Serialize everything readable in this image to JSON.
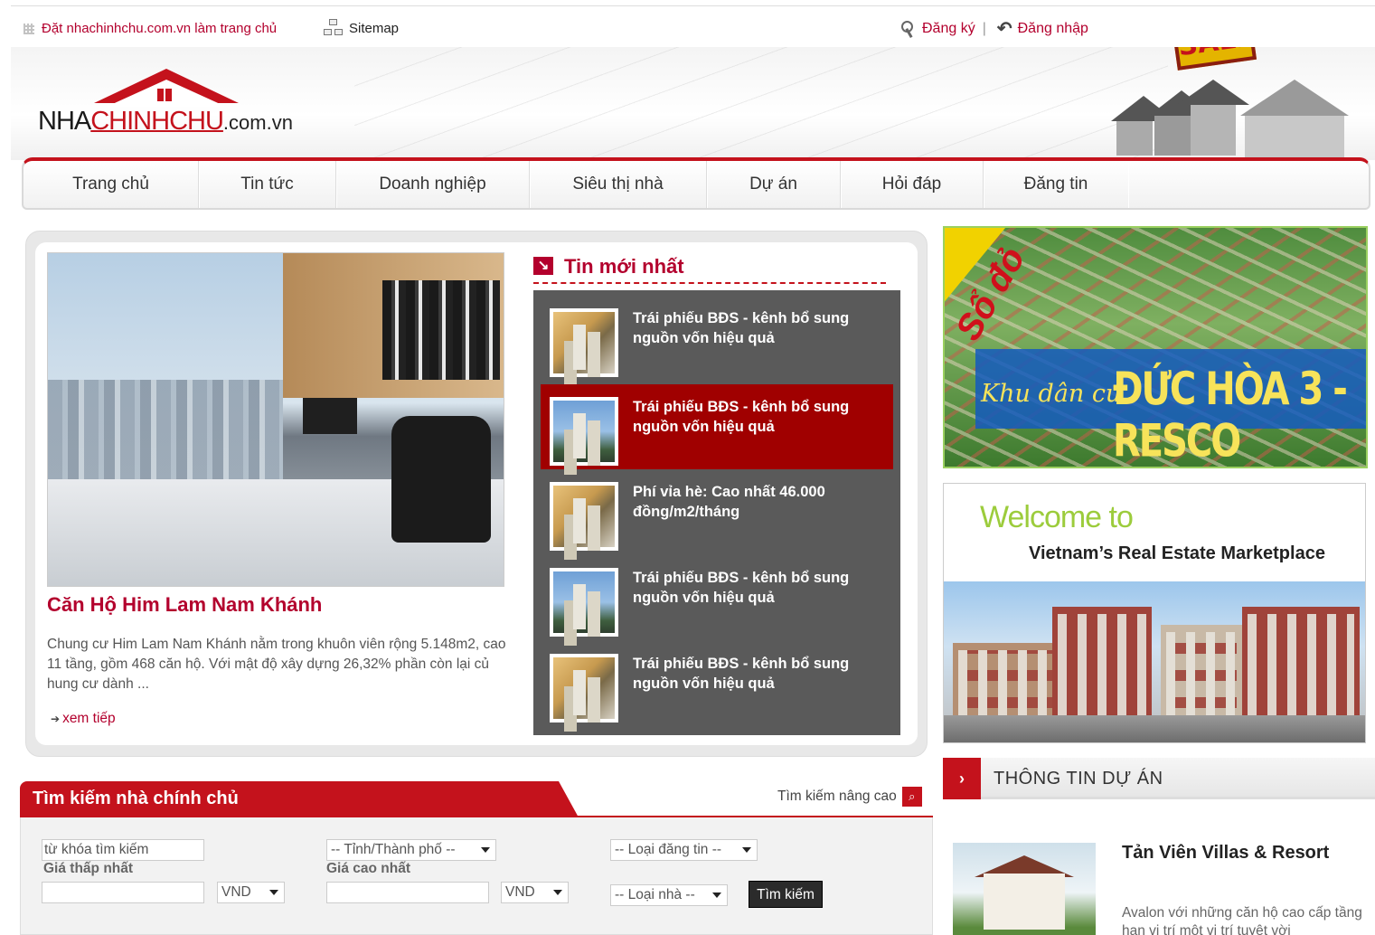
{
  "topbar": {
    "homepage_link": "Đặt nhachinhchu.com.vn làm trang chủ",
    "sitemap": "Sitemap",
    "register": "Đăng ký",
    "separator": "|",
    "login": "Đăng nhập"
  },
  "logo": {
    "part1": "NHA",
    "part2": "CHINHCHU",
    "domain": ".com.vn"
  },
  "sale_sign": "SALE",
  "nav": {
    "items": [
      "Trang chủ",
      "Tin tức",
      "Doanh nghiệp",
      "Siêu thị nhà",
      "Dự án",
      "Hỏi đáp",
      "Đăng tin"
    ]
  },
  "featured": {
    "title": "Căn Hộ Him Lam Nam Khánh",
    "description": "Chung cư Him Lam Nam Khánh nằm trong khuôn viên rộng 5.148m2, cao 11 tầng, gồm 468 căn hộ. Với mật độ xây dựng 26,32% phần còn lại củ hung cư dành ...",
    "more_label": "xem tiếp"
  },
  "latest": {
    "heading": "Tin mới nhất",
    "items": [
      {
        "title": "Trái phiếu BĐS - kênh bổ sung nguồn vốn hiệu quả",
        "thumb": "interior-photo",
        "active": false
      },
      {
        "title": "Trái phiếu BĐS - kênh bổ sung nguồn vốn hiệu quả",
        "thumb": "tower-photo",
        "active": true
      },
      {
        "title": "Phí vỉa hè: Cao nhất 46.000 đồng/m2/tháng",
        "thumb": "interior-photo",
        "active": false
      },
      {
        "title": "Trái phiếu BĐS - kênh bổ sung nguồn vốn hiệu quả",
        "thumb": "tower-photo",
        "active": false
      },
      {
        "title": "Trái phiếu BĐS - kênh bổ sung nguồn vốn hiệu quả",
        "thumb": "interior-photo",
        "active": false
      }
    ]
  },
  "ad_resco": {
    "corner": "Sổ đỏ",
    "prefix": "Khu dân cư",
    "name": "ĐỨC HÒA 3 - RESCO"
  },
  "ad_welcome": {
    "welcome": "Welcome to",
    "tagline": "Vietnam’s Real Estate Marketplace"
  },
  "projects": {
    "heading": "THÔNG TIN DỰ ÁN",
    "item": {
      "title": "Tản Viên Villas & Resort",
      "description": "Avalon với những căn hộ cao cấp tầng hạn vị trí một vị trí tuyệt vời"
    }
  },
  "search": {
    "title": "Tìm kiếm nhà chính chủ",
    "advanced": "Tìm kiếm nâng cao",
    "keyword_value": "từ khóa tìm kiếm",
    "city_select": "-- Tỉnh/Thành phố --",
    "post_type_select": "-- Loại đăng tin --",
    "min_price_label": "Giá thấp nhất",
    "max_price_label": "Giá cao nhất",
    "currency1": "VND",
    "currency2": "VND",
    "house_type_select": "-- Loại nhà --",
    "submit": "Tìm kiếm"
  },
  "colors": {
    "brand_red": "#c4121c",
    "dark_panel": "#5a5a5a",
    "active_item": "#a00000"
  }
}
